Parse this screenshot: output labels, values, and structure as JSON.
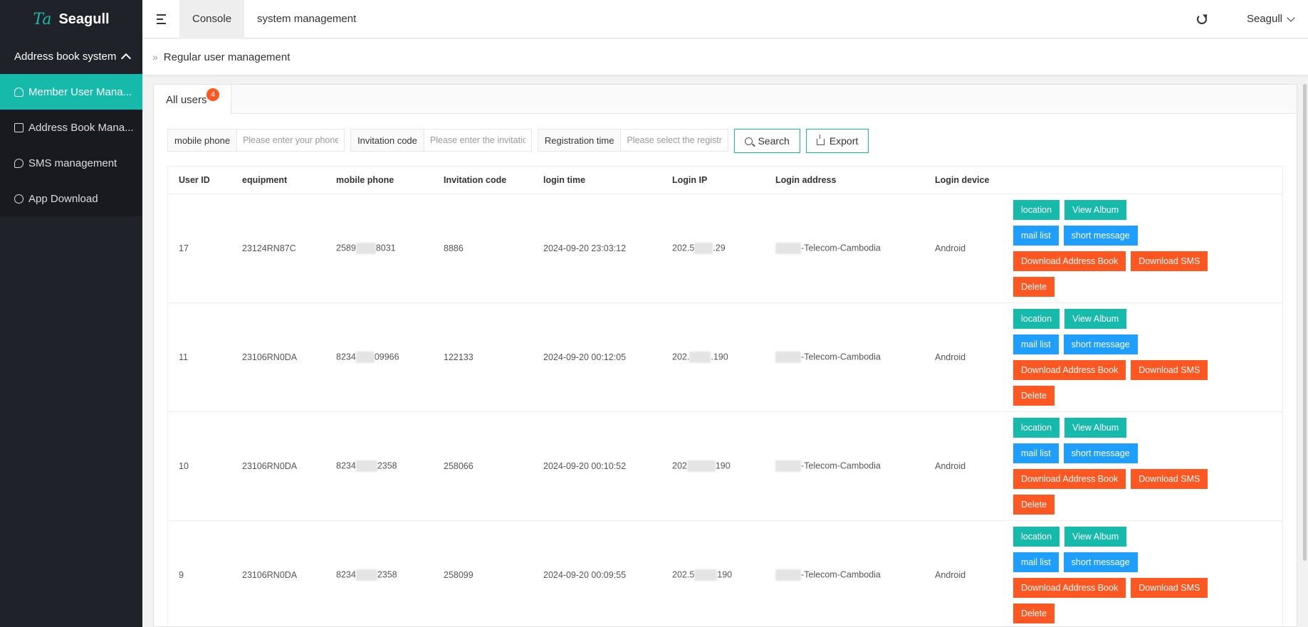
{
  "app": {
    "logo_mark": "Ta",
    "logo_text": "Seagull"
  },
  "sidebar": {
    "group_label": "Address book system",
    "items": [
      {
        "label": "Member User Mana...",
        "icon": "user-icon"
      },
      {
        "label": "Address Book Mana...",
        "icon": "book-icon"
      },
      {
        "label": "SMS management",
        "icon": "chat-icon"
      },
      {
        "label": "App Download",
        "icon": "download-icon"
      }
    ]
  },
  "header": {
    "tabs": [
      {
        "label": "Console"
      },
      {
        "label": "system management"
      }
    ],
    "user": "Seagull"
  },
  "breadcrumb": {
    "sep": "»",
    "title": "Regular user management"
  },
  "card": {
    "tab_label": "All users",
    "badge": "4"
  },
  "filters": {
    "phone_label": "mobile phone",
    "phone_placeholder": "Please enter your phone",
    "invite_label": "Invitation code",
    "invite_placeholder": "Please enter the invitatio",
    "reg_label": "Registration time",
    "reg_placeholder": "Please select the registr",
    "search_label": "Search",
    "export_label": "Export"
  },
  "table": {
    "columns": [
      "User ID",
      "equipment",
      "mobile phone",
      "Invitation code",
      "login time",
      "Login IP",
      "Login address",
      "Login device"
    ],
    "rows": [
      {
        "id": "17",
        "equipment": "23124RN87C",
        "phone_a": "2589",
        "phone_b": "8031",
        "code": "8886",
        "time": "2024-09-20 23:03:12",
        "ip_a": "202.5",
        "ip_b": ".29",
        "address": "-Telecom-Cambodia",
        "device": "Android"
      },
      {
        "id": "11",
        "equipment": "23106RN0DA",
        "phone_a": "8234",
        "phone_b": "09966",
        "code": "122133",
        "time": "2024-09-20 00:12:05",
        "ip_a": "202.",
        "ip_b": ".190",
        "address": "-Telecom-Cambodia",
        "device": "Android"
      },
      {
        "id": "10",
        "equipment": "23106RN0DA",
        "phone_a": "8234",
        "phone_b": "2358",
        "code": "258066",
        "time": "2024-09-20 00:10:52",
        "ip_a": "202",
        "ip_b": "190",
        "address": "-Telecom-Cambodia",
        "device": "Android"
      },
      {
        "id": "9",
        "equipment": "23106RN0DA",
        "phone_a": "8234",
        "phone_b": "2358",
        "code": "258099",
        "time": "2024-09-20 00:09:55",
        "ip_a": "202.5",
        "ip_b": "190",
        "address": "-Telecom-Cambodia",
        "device": "Android"
      }
    ]
  },
  "actions": {
    "location": "location",
    "view_album": "View Album",
    "mail_list": "mail list",
    "short_message": "short message",
    "download_address_book": "Download Address Book",
    "download_sms": "Download SMS",
    "delete": "Delete"
  },
  "colors": {
    "sidebar": "#20222a",
    "accent": "#16baaa",
    "blue": "#1e9fff",
    "orange": "#ff5722"
  }
}
